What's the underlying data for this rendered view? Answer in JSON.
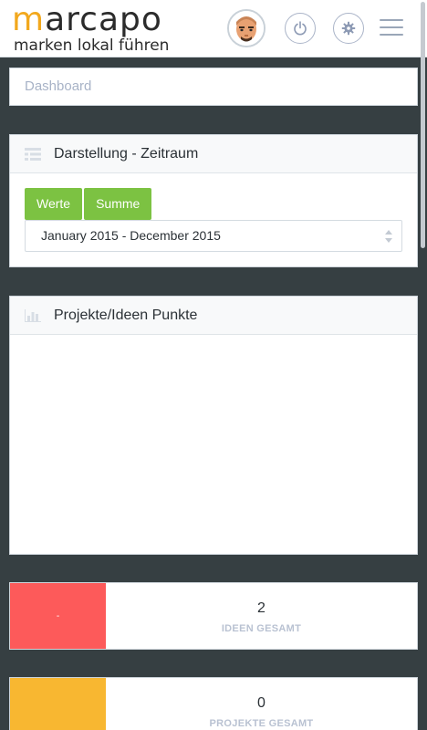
{
  "header": {
    "logo_word": "arcapo",
    "logo_initial": "m",
    "logo_tagline": "marken lokal führen",
    "icons": [
      "avatar",
      "power-icon",
      "gear-icon",
      "hamburger-menu-icon"
    ]
  },
  "breadcrumb": {
    "label": "Dashboard"
  },
  "zeitraum_panel": {
    "title": "Darstellung - Zeitraum",
    "buttons": [
      {
        "label": "Werte"
      },
      {
        "label": "Summe"
      }
    ],
    "range_select": {
      "value": "January 2015 - December 2015"
    }
  },
  "punkte_panel": {
    "title": "Projekte/Ideen Punkte"
  },
  "stats": [
    {
      "swatch_text": "-",
      "value": "2",
      "label": "IDEEN GESAMT",
      "color": "#fd5a5a"
    },
    {
      "swatch_text": "",
      "value": "0",
      "label": "PROJEKTE GESAMT",
      "color": "#f8b731"
    }
  ],
  "colors": {
    "accent_green": "#7cc242",
    "background": "#363f42",
    "logo_orange": "#f2a81d"
  }
}
